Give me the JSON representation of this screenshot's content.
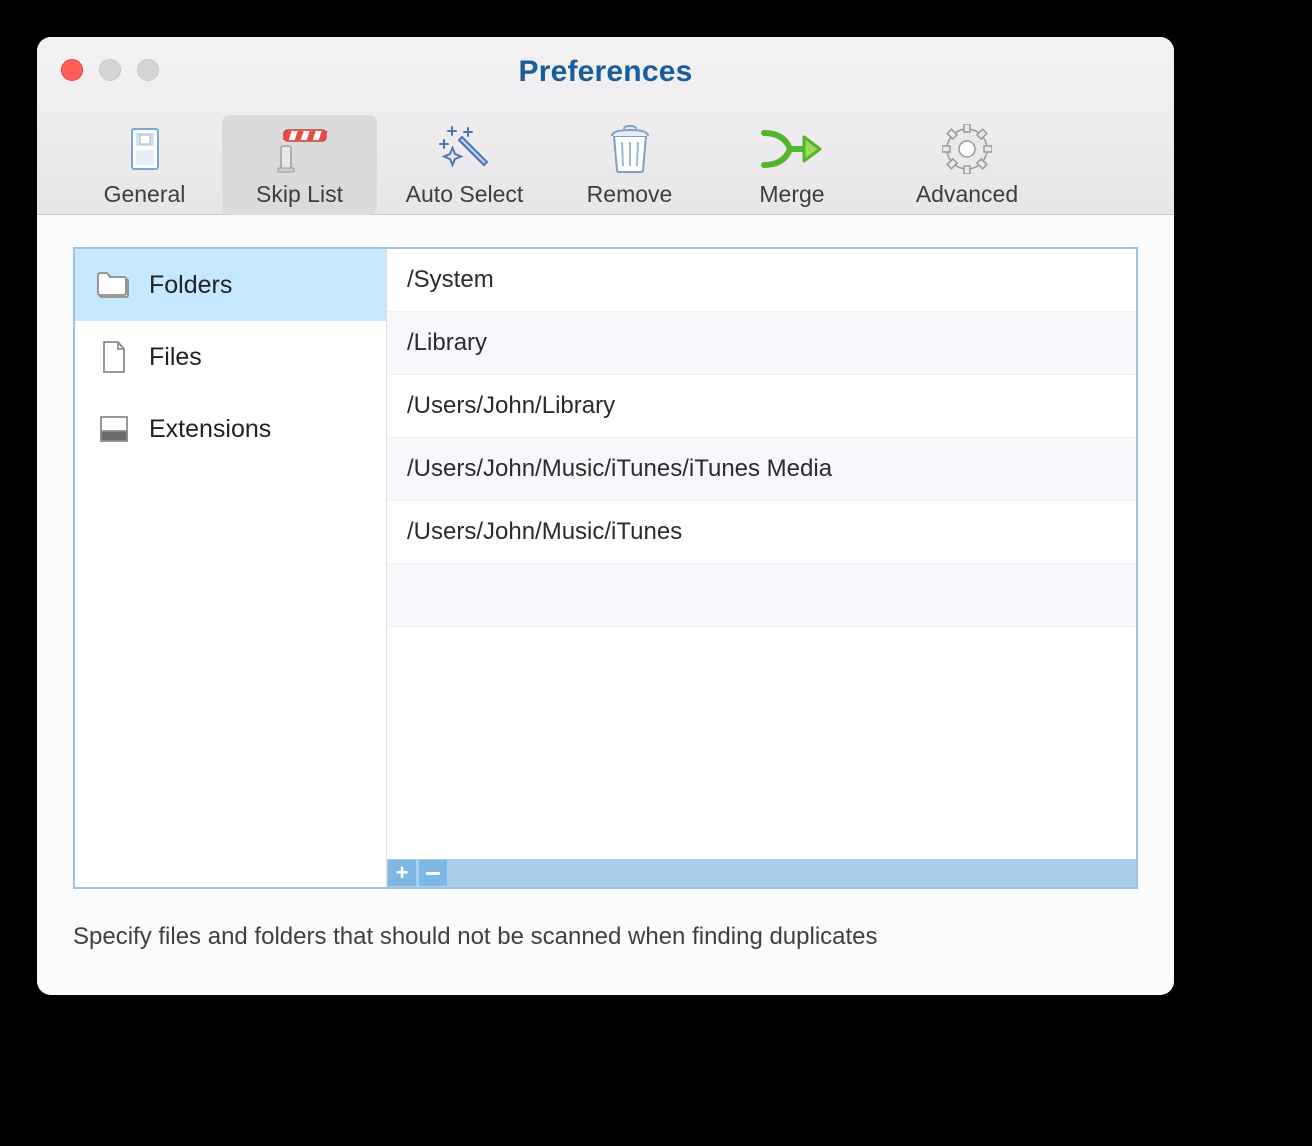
{
  "window": {
    "title": "Preferences"
  },
  "toolbar": {
    "tabs": [
      {
        "id": "general",
        "label": "General"
      },
      {
        "id": "skiplist",
        "label": "Skip List"
      },
      {
        "id": "autoselect",
        "label": "Auto Select"
      },
      {
        "id": "remove",
        "label": "Remove"
      },
      {
        "id": "merge",
        "label": "Merge"
      },
      {
        "id": "advanced",
        "label": "Advanced"
      }
    ],
    "active": "skiplist"
  },
  "sidebar": {
    "items": [
      {
        "id": "folders",
        "label": "Folders"
      },
      {
        "id": "files",
        "label": "Files"
      },
      {
        "id": "extensions",
        "label": "Extensions"
      }
    ],
    "selected": "folders"
  },
  "skip_list": {
    "rows": [
      "/System",
      "/Library",
      "/Users/John/Library",
      "/Users/John/Music/iTunes/iTunes Media",
      "/Users/John/Music/iTunes"
    ]
  },
  "footer_buttons": {
    "add": "+",
    "remove": "−"
  },
  "description": "Specify files and folders that should not be scanned when finding duplicates",
  "colors": {
    "accent": "#9ec2e3",
    "title": "#1a5d9e",
    "selected_row": "#c6e8ff"
  }
}
